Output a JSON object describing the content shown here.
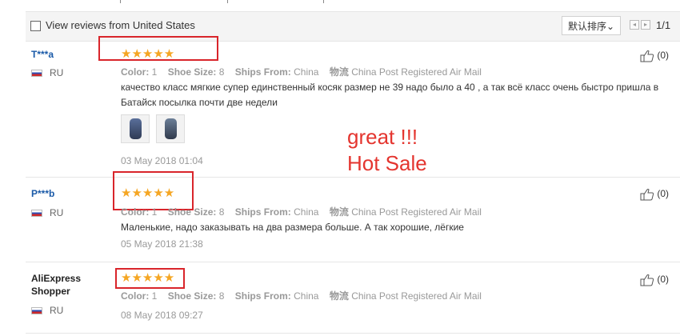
{
  "filter": {
    "checkbox_label": "View reviews from United States",
    "sort_label": "默认排序",
    "sort_arrow": "⌄",
    "page_prev": "◂",
    "page_next": "▸",
    "page_indicator": "1/1"
  },
  "star_glyphs": "★★★★★",
  "meta_labels": {
    "color": "Color:",
    "shoe_size": "Shoe Size:",
    "ships_from": "Ships From:",
    "logistics": "物流"
  },
  "reviews": [
    {
      "user": "T***a",
      "country": "RU",
      "rating": 5,
      "color": "1",
      "shoe_size": "8",
      "ships_from": "China",
      "logistics": "China Post Registered Air Mail",
      "text": "качество класс мягкие супер единственный косяк размер не 39 надо было а 40 , а так всё класс очень быстро пришла в Батайск посылка почти две недели",
      "date": "03 May 2018 01:04",
      "likes": "(0)",
      "photos": 2
    },
    {
      "user": "P***b",
      "country": "RU",
      "rating": 5,
      "color": "1",
      "shoe_size": "8",
      "ships_from": "China",
      "logistics": "China Post Registered Air Mail",
      "text": "Маленькие, надо заказывать на два размера больше. А так хорошие, лёгкие",
      "date": "05 May 2018 21:38",
      "likes": "(0)"
    },
    {
      "user": "AliExpress Shopper",
      "country": "RU",
      "rating": 5,
      "color": "1",
      "shoe_size": "8",
      "ships_from": "China",
      "logistics": "China Post Registered Air Mail",
      "date": "08 May 2018 09:27",
      "likes": "(0)"
    }
  ],
  "annotation": {
    "line1": "great !!!",
    "line2": "Hot Sale",
    "color": "#e4352f"
  },
  "colors": {
    "accent_user": "#1a5aa8",
    "star": "#f5a623",
    "highlight_box": "#d9252b"
  }
}
